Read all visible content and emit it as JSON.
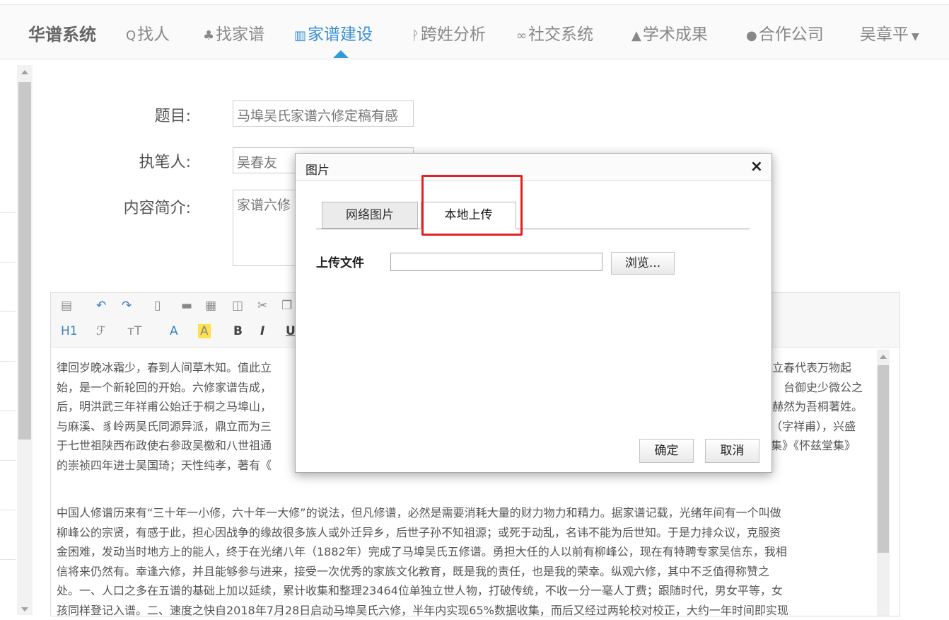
{
  "nav": {
    "brand": "华谱系统",
    "items": [
      {
        "label": "找人",
        "icon": "search-icon"
      },
      {
        "label": "找家谱",
        "icon": "tree-icon"
      },
      {
        "label": "家谱建设",
        "icon": "book-icon"
      },
      {
        "label": "跨姓分析",
        "icon": "branch-icon"
      },
      {
        "label": "社交系统",
        "icon": "link-icon"
      },
      {
        "label": "学术成果",
        "icon": "graduation-cap-icon"
      },
      {
        "label": "合作公司",
        "icon": "users-icon"
      }
    ],
    "user": "吴章平",
    "active_color": "#3a8fd6"
  },
  "form": {
    "title_label": "题目:",
    "title_value": "马埠吴氏家谱六修定稿有感",
    "author_label": "执笔人:",
    "author_value": "吴春友",
    "summary_label": "内容简介:",
    "summary_value": "家谱六修"
  },
  "toolbar": {
    "heading": "H1",
    "font_family": "ℱ",
    "font_size": "тT",
    "font_color": "A",
    "highlight": "A",
    "bold": "B",
    "italic": "I",
    "underline": "U"
  },
  "editor": {
    "paragraph1": [
      "律回岁晚冰霜少，春到人间草木知。值此立",
      "立春代表万物起",
      "始，是一个新轮回的开始。六修家谱告成，",
      "台御史少微公之",
      "后，明洪武三年祥甫公始迁于桐之马埠山，",
      "赫然为吾桐著姓。",
      "与麻溪、豸岭两吴氏同源异派，鼎立而为三",
      "（字祥甫），兴盛",
      "于七世祖陕西布政使右参政吴檄和八世祖通",
      "集》《怀兹堂集》",
      "的崇祯四年进士吴国琦；天性纯孝，著有《"
    ],
    "paragraph2": [
      "中国人修谱历来有“三十年一小修，六十年一大修”的说法，但凡修谱，必然是需要消耗大量的财力物力和精力。据家谱记载，光绪年间有一个叫做",
      "柳峰公的宗贤，有感于此，担心因战争的缘故很多族人或外迁异乡，后世子孙不知祖源；或死于动乱，名讳不能为后世知。于是力排众议，克服资",
      "金困难，发动当时地方上的能人，终于在光绪八年（1882年）完成了马埠吴氏五修谱。勇担大任的人以前有柳峰公，现在有特聘专家吴信东，我相",
      "信将来仍然有。幸逢六修，并且能够参与进来，接受一次优秀的家族文化教育，既是我的责任，也是我的荣幸。纵观六修，其中不乏值得称赞之",
      "处。一、人口之多在五谱的基础上加以延续，累计收集和整理23464位单独立世人物，打破传统，不收一分一毫人丁费；跟随时代，男女平等，女",
      "孩同样登记入谱。二、速度之快自2018年7月28日启动马埠吴氏六修，半年内实现65%数据收集，而后又经过两轮校对校正，大约一年时间即实现"
    ]
  },
  "dialog": {
    "title": "图片",
    "close": "×",
    "tabs": [
      "网络图片",
      "本地上传"
    ],
    "upload_label": "上传文件",
    "browse": "浏览...",
    "ok": "确定",
    "cancel": "取消",
    "highlight_color": "#e52020"
  }
}
